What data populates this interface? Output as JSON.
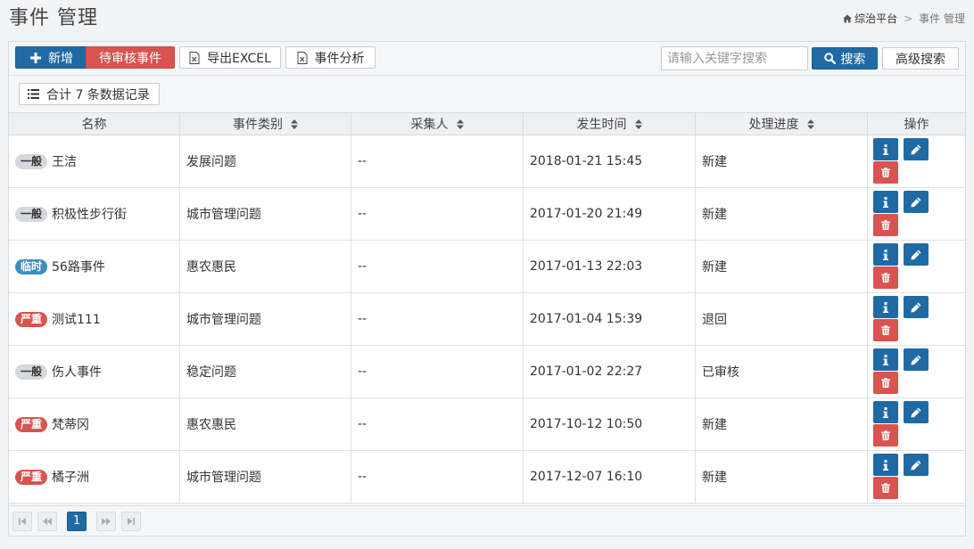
{
  "header": {
    "title": "事件 管理",
    "breadcrumb": {
      "home": "综治平台",
      "separator": ">",
      "current": "事件 管理"
    }
  },
  "toolbar": {
    "add_label": "新增",
    "pending_label": "待审核事件",
    "export_label": "导出EXCEL",
    "analysis_label": "事件分析",
    "search_placeholder": "请输入关键字搜索",
    "search_value": "",
    "search_label": "搜索",
    "advanced_label": "高级搜索"
  },
  "summary": {
    "count_text": "合计 7 条数据记录"
  },
  "table": {
    "columns": [
      "名称",
      "事件类别",
      "采集人",
      "发生时间",
      "处理进度",
      "操作"
    ],
    "rows": [
      {
        "level": "一般",
        "level_type": "normal",
        "name": "王洁",
        "category": "发展问题",
        "collector": "--",
        "time": "2018-01-21 15:45",
        "status": "新建"
      },
      {
        "level": "一般",
        "level_type": "normal",
        "name": "积极性步行街",
        "category": "城市管理问题",
        "collector": "--",
        "time": "2017-01-20 21:49",
        "status": "新建"
      },
      {
        "level": "临时",
        "level_type": "temp",
        "name": "56路事件",
        "category": "惠农惠民",
        "collector": "--",
        "time": "2017-01-13 22:03",
        "status": "新建"
      },
      {
        "level": "严重",
        "level_type": "severe",
        "name": "测试111",
        "category": "城市管理问题",
        "collector": "--",
        "time": "2017-01-04 15:39",
        "status": "退回"
      },
      {
        "level": "一般",
        "level_type": "normal",
        "name": "伤人事件",
        "category": "稳定问题",
        "collector": "--",
        "time": "2017-01-02 22:27",
        "status": "已审核"
      },
      {
        "level": "严重",
        "level_type": "severe",
        "name": "梵蒂冈",
        "category": "惠农惠民",
        "collector": "--",
        "time": "2017-10-12 10:50",
        "status": "新建"
      },
      {
        "level": "严重",
        "level_type": "severe",
        "name": "橘子洲",
        "category": "城市管理问题",
        "collector": "--",
        "time": "2017-12-07 16:10",
        "status": "新建"
      }
    ]
  },
  "pagination": {
    "current_page": "1"
  },
  "icons": {
    "home": "home-icon",
    "plus": "plus-icon",
    "file": "file-icon",
    "search": "search-icon",
    "list": "list-icon",
    "sort": "sort-icon",
    "info": "info-icon",
    "edit": "pencil-icon",
    "delete": "trash-icon",
    "first": "first-page-icon",
    "prev": "prev-page-icon",
    "next": "next-page-icon",
    "last": "last-page-icon"
  },
  "colors": {
    "primary": "#1f6aa5",
    "danger": "#d9534f",
    "badge_temp": "#3d8dc0",
    "badge_normal": "#d5d8dd"
  }
}
